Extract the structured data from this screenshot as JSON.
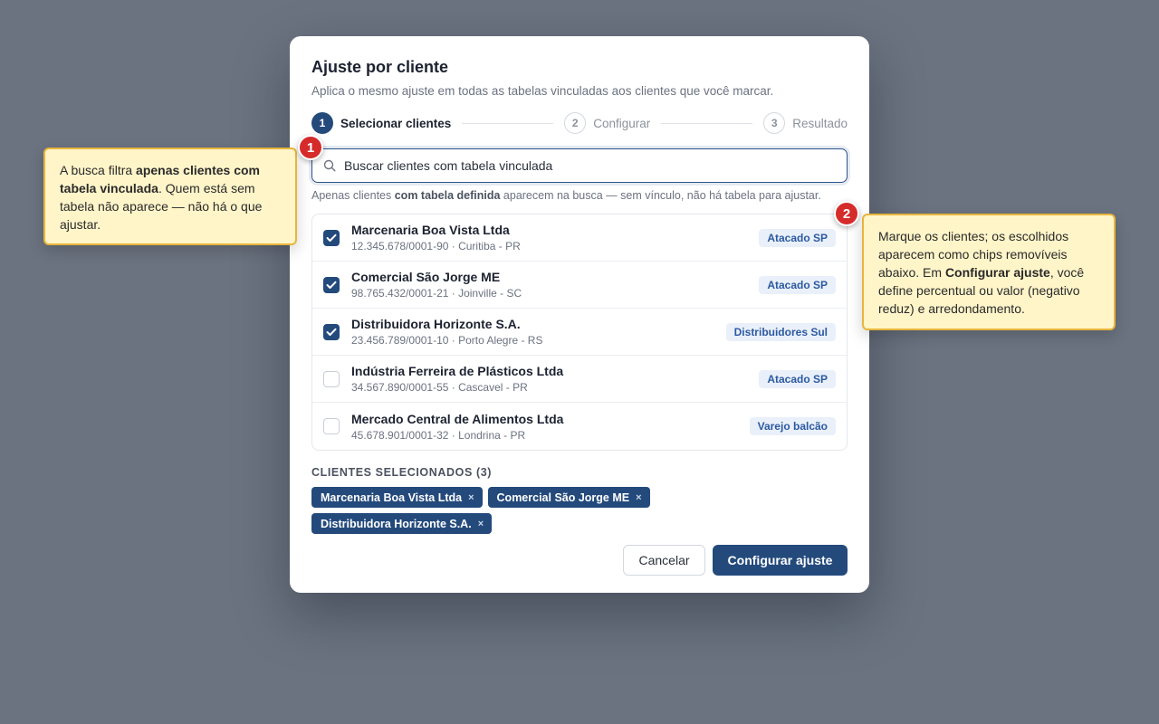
{
  "modal": {
    "title": "Ajuste por cliente",
    "subtitle": "Aplica o mesmo ajuste em todas as tabelas vinculadas aos clientes que você marcar."
  },
  "stepper": [
    {
      "num": "1",
      "label": "Selecionar clientes",
      "state": "active"
    },
    {
      "num": "2",
      "label": "Configurar",
      "state": "idle"
    },
    {
      "num": "3",
      "label": "Resultado",
      "state": "idle"
    }
  ],
  "search": {
    "placeholder": "Buscar clientes com tabela vinculada",
    "icon": "search-icon",
    "hint_pre": "Apenas clientes ",
    "hint_bold": "com tabela definida",
    "hint_post": " aparecem na busca — sem vínculo, não há tabela para ajustar."
  },
  "clients": [
    {
      "name": "Marcenaria Boa Vista Ltda",
      "meta": "12.345.678/0001-90 · Curitiba - PR",
      "table": "Atacado SP",
      "checked": true
    },
    {
      "name": "Comercial São Jorge ME",
      "meta": "98.765.432/0001-21 · Joinville - SC",
      "table": "Atacado SP",
      "checked": true
    },
    {
      "name": "Distribuidora Horizonte S.A.",
      "meta": "23.456.789/0001-10 · Porto Alegre - RS",
      "table": "Distribuidores Sul",
      "checked": true
    },
    {
      "name": "Indústria Ferreira de Plásticos Ltda",
      "meta": "34.567.890/0001-55 · Cascavel - PR",
      "table": "Atacado SP",
      "checked": false
    },
    {
      "name": "Mercado Central de Alimentos Ltda",
      "meta": "45.678.901/0001-32 · Londrina - PR",
      "table": "Varejo balcão",
      "checked": false
    }
  ],
  "selected": {
    "title": "CLIENTES SELECIONADOS (3)",
    "chips": [
      "Marcenaria Boa Vista Ltda",
      "Comercial São Jorge ME",
      "Distribuidora Horizonte S.A."
    ],
    "remove_glyph": "×"
  },
  "footer": {
    "cancel": "Cancelar",
    "primary": "Configurar ajuste"
  },
  "annotations": {
    "one": {
      "marker": "1",
      "t1": "A busca filtra ",
      "b1": "apenas clientes com tabela vinculada",
      "t2": ". Quem está sem tabela não aparece — não há o que ajustar."
    },
    "two": {
      "marker": "2",
      "t1": "Marque os clientes; os escolhidos aparecem como chips removíveis abaixo. Em ",
      "b1": "Configurar ajuste",
      "t2": ", você define percentual ou valor (negativo reduz) e arredondamento."
    }
  },
  "colors": {
    "accent": "#244a7c",
    "tag_text": "#2c5aa0",
    "tag_bg": "#eaf0f9",
    "callout_bg": "#fff5c9",
    "callout_border": "#e8b53c",
    "marker": "#d52b2b",
    "backdrop": "#6b7380"
  }
}
